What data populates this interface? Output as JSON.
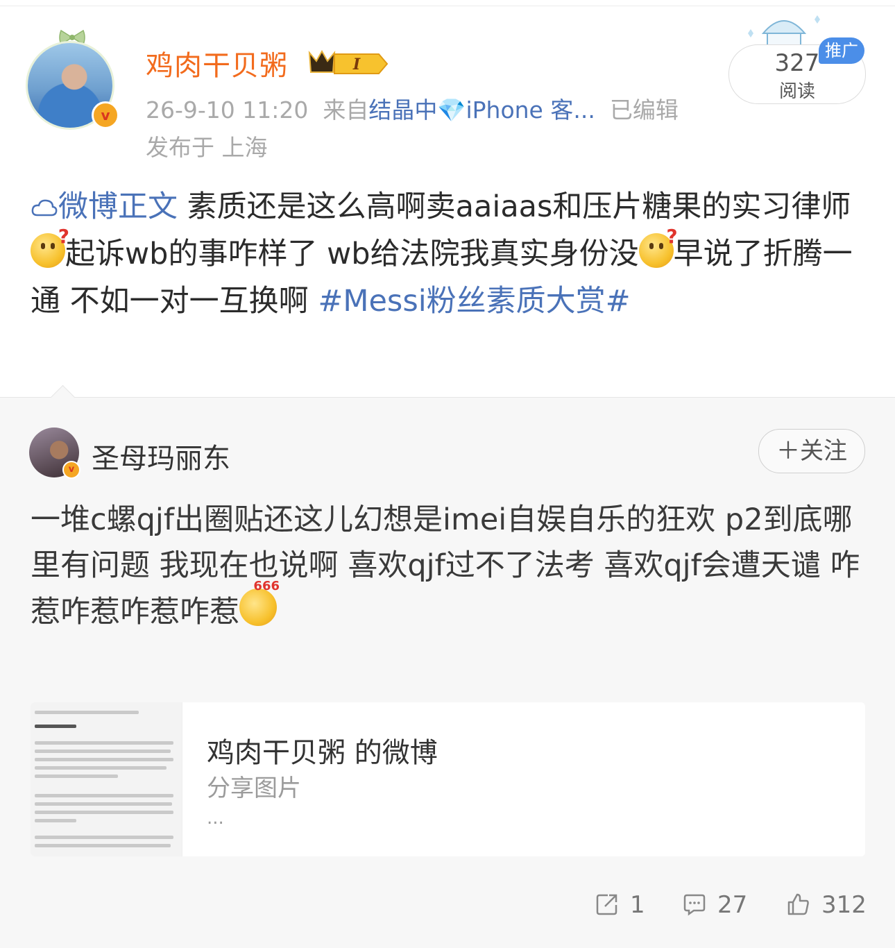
{
  "post": {
    "username": "鸡肉干贝粥",
    "level_badge": "I",
    "timestamp": "26-9-10 11:20",
    "source_prefix": "来自",
    "source_name": "结晶中",
    "source_emoji": "💎",
    "source_device": "iPhone 客...",
    "edited": "已编辑",
    "location": "发布于 上海",
    "read_count": "327",
    "read_label": "阅读",
    "promo_label": "推广",
    "text_prefix": "微博正文",
    "text_1": " 素质还是这么高啊卖aaiaas和压片糖果的实习律师",
    "text_2": "起诉wb的事咋样了 wb给法院我真实身份没",
    "text_3": "早说了折腾一通 不如一对一互换啊 ",
    "hashtag": "#Messi粉丝素质大赏#"
  },
  "repost": {
    "username": "圣母玛丽东",
    "follow_label": "＋关注",
    "text": "一堆c螺qjf出圈贴还这儿幻想是imei自娱自乐的狂欢 p2到底哪里有问题 我现在也说啊 喜欢qjf过不了法考 喜欢qjf会遭天谴 咋惹咋惹咋惹咋惹",
    "emoji_label": "666",
    "card": {
      "title": "鸡肉干贝粥 的微博",
      "subtitle": "分享图片",
      "more": "..."
    },
    "actions": {
      "repost_count": "1",
      "comment_count": "27",
      "like_count": "312"
    }
  },
  "colors": {
    "username": "#f26b1d",
    "link_blue": "#4a72b8",
    "promo_bg": "#4b8ee8"
  }
}
